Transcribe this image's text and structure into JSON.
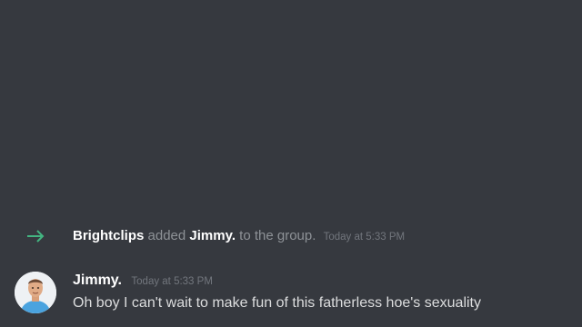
{
  "colors": {
    "background": "#36393f",
    "join_arrow": "#43b581",
    "username": "#ffffff",
    "muted_text": "#8e9297",
    "timestamp": "#72767d",
    "message_text": "#dcddde"
  },
  "system_message": {
    "icon": "arrow-right-icon",
    "actor": "Brightclips",
    "verb": "added",
    "target": "Jimmy.",
    "suffix": "to the group.",
    "timestamp": "Today at 5:33 PM"
  },
  "message": {
    "avatar_icon": "avatar",
    "author": "Jimmy.",
    "timestamp": "Today at 5:33 PM",
    "content": "Oh boy I can't wait to make fun of this fatherless hoe's sexuality"
  }
}
